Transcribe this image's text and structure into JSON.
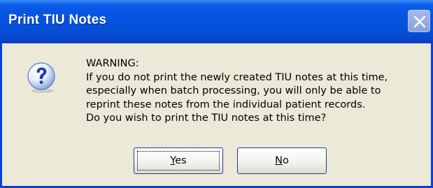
{
  "window": {
    "title": "Print TIU Notes"
  },
  "dialog": {
    "icon": "question-icon",
    "message_lines": [
      "WARNING:",
      "If you do not print the newly created TIU notes at this time,",
      "especially when batch processing, you will only be able to",
      "reprint these notes from the individual patient records.",
      "Do you wish to print the TIU notes at this time?"
    ]
  },
  "buttons": {
    "yes_label": "Yes",
    "no_label": "No"
  }
}
